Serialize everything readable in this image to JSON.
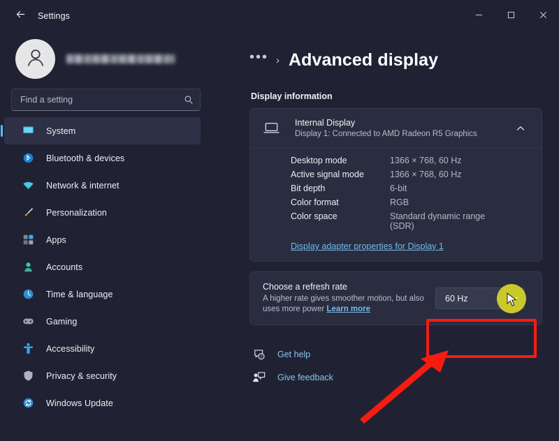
{
  "window": {
    "title": "Settings",
    "back_icon": "back-arrow-icon",
    "controls": {
      "minimize": "minimize-icon",
      "maximize": "maximize-icon",
      "close": "close-icon"
    }
  },
  "sidebar": {
    "account": {
      "name_redacted": "",
      "avatar_icon": "person-avatar-icon"
    },
    "search": {
      "value": "",
      "placeholder": "Find a setting",
      "icon": "search-icon"
    },
    "items": [
      {
        "label": "System",
        "icon": "monitor-icon",
        "selected": true
      },
      {
        "label": "Bluetooth & devices",
        "icon": "bluetooth-icon",
        "selected": false
      },
      {
        "label": "Network & internet",
        "icon": "wifi-icon",
        "selected": false
      },
      {
        "label": "Personalization",
        "icon": "paintbrush-icon",
        "selected": false
      },
      {
        "label": "Apps",
        "icon": "apps-icon",
        "selected": false
      },
      {
        "label": "Accounts",
        "icon": "account-icon",
        "selected": false
      },
      {
        "label": "Time & language",
        "icon": "clock-icon",
        "selected": false
      },
      {
        "label": "Gaming",
        "icon": "gamepad-icon",
        "selected": false
      },
      {
        "label": "Accessibility",
        "icon": "accessibility-icon",
        "selected": false
      },
      {
        "label": "Privacy & security",
        "icon": "shield-icon",
        "selected": false
      },
      {
        "label": "Windows Update",
        "icon": "update-icon",
        "selected": false
      }
    ]
  },
  "main": {
    "breadcrumb": {
      "ellipsis": "•••",
      "separator": "›"
    },
    "page_title": "Advanced display",
    "section_label": "Display information",
    "display_card": {
      "icon": "laptop-icon",
      "title": "Internal Display",
      "subtitle": "Display 1: Connected to AMD Radeon R5 Graphics",
      "collapse_icon": "chevron-up-icon",
      "rows": [
        {
          "key": "Desktop mode",
          "value": "1366 × 768, 60 Hz"
        },
        {
          "key": "Active signal mode",
          "value": "1366 × 768, 60 Hz"
        },
        {
          "key": "Bit depth",
          "value": "6-bit"
        },
        {
          "key": "Color format",
          "value": "RGB"
        },
        {
          "key": "Color space",
          "value": "Standard dynamic range (SDR)"
        }
      ],
      "adapter_link": "Display adapter properties for Display 1"
    },
    "refresh_rate": {
      "title": "Choose a refresh rate",
      "description": "A higher rate gives smoother motion, but also uses more power",
      "learn_more": "Learn more",
      "selected_value": "60 Hz",
      "chevron_icon": "chevron-down-icon"
    },
    "footer_links": [
      {
        "label": "Get help",
        "icon": "help-icon"
      },
      {
        "label": "Give feedback",
        "icon": "feedback-icon"
      }
    ]
  },
  "annotations": {
    "highlight_color": "#f61c12",
    "cursor_halo_color": "#c9c92b"
  }
}
